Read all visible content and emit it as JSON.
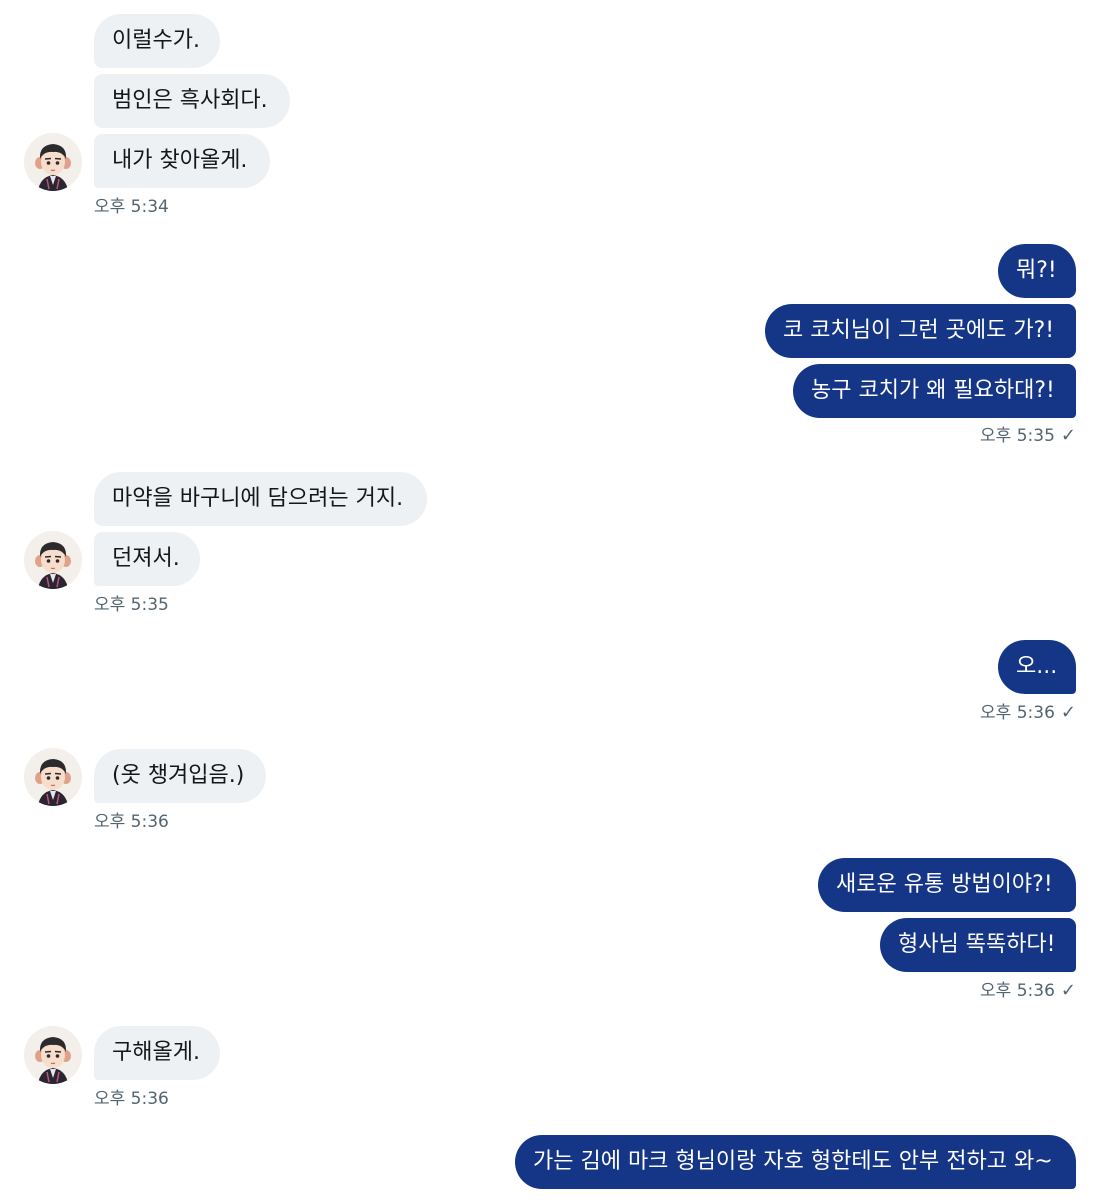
{
  "groups": [
    {
      "side": "in",
      "messages": [
        "이럴수가.",
        "범인은 흑사회다.",
        "내가 찾아올게."
      ],
      "time": "오후 5:34",
      "avatar": "character-avatar-icon"
    },
    {
      "side": "out",
      "messages": [
        "뭐?!",
        "코 코치님이 그런 곳에도 가?!",
        "농구 코치가 왜 필요하대?!"
      ],
      "time": "오후 5:35",
      "receipt": "✓"
    },
    {
      "side": "in",
      "messages": [
        "마약을 바구니에 담으려는 거지.",
        "던져서."
      ],
      "time": "오후 5:35",
      "avatar": "character-avatar-icon"
    },
    {
      "side": "out",
      "messages": [
        "오..."
      ],
      "time": "오후 5:36",
      "receipt": "✓"
    },
    {
      "side": "in",
      "messages": [
        "(옷 챙겨입음.)"
      ],
      "time": "오후 5:36",
      "avatar": "character-avatar-icon"
    },
    {
      "side": "out",
      "messages": [
        "새로운 유통 방법이야?!",
        "형사님 똑똑하다!"
      ],
      "time": "오후 5:36",
      "receipt": "✓"
    },
    {
      "side": "in",
      "messages": [
        "구해올게."
      ],
      "time": "오후 5:36",
      "avatar": "character-avatar-icon"
    },
    {
      "side": "out",
      "messages": [
        "가는 김에 마크 형님이랑 자호 형한테도 안부 전하고 와~"
      ],
      "time": "",
      "receipt": ""
    }
  ],
  "colors": {
    "incoming_bubble": "#eef1f4",
    "outgoing_bubble": "#153587",
    "timestamp": "#536471"
  }
}
